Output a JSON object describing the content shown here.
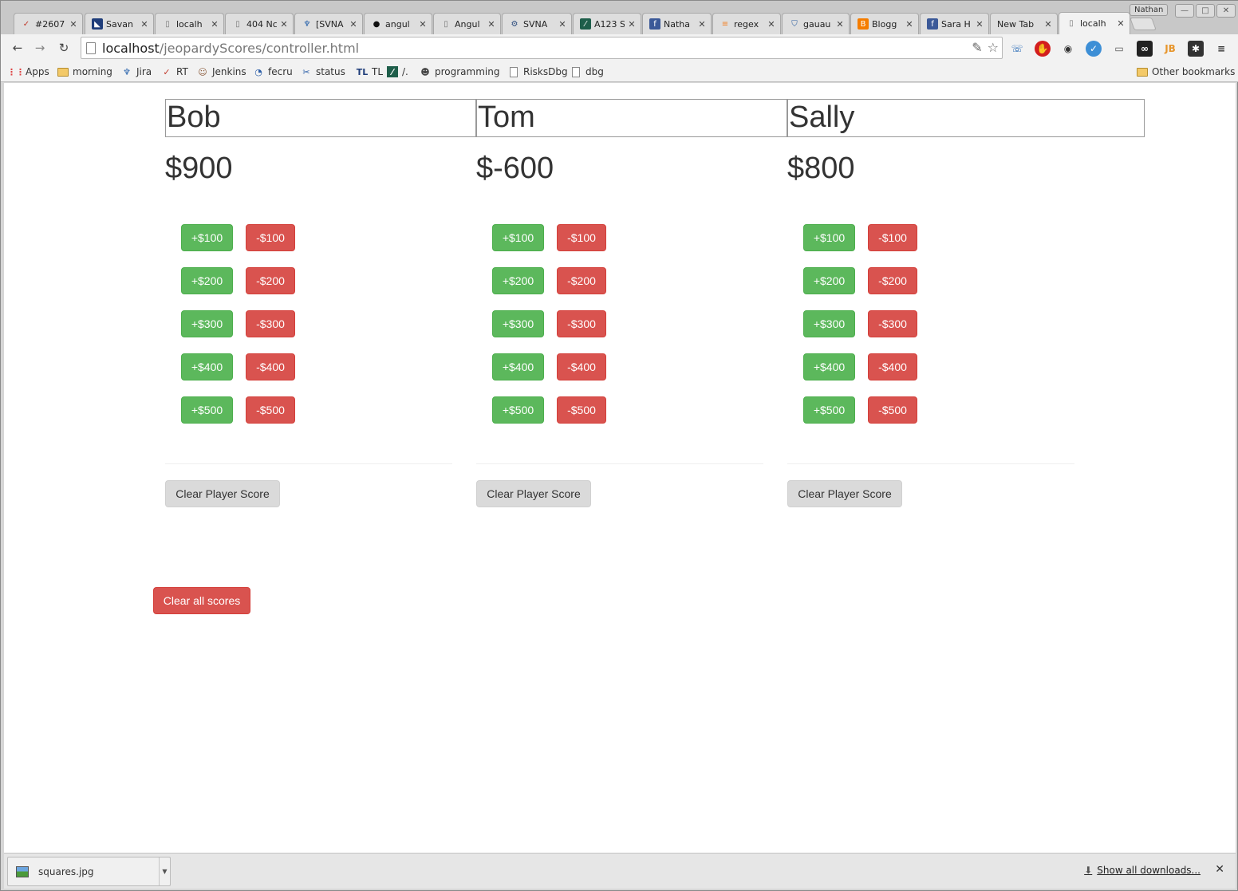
{
  "window": {
    "profile_name": "Nathan",
    "controls": {
      "minimize": "—",
      "maximize": "□",
      "close": "✕"
    }
  },
  "tabs": [
    {
      "title": "#2607",
      "icon": "checkmark-icon"
    },
    {
      "title": "Savan",
      "icon": "savannah-icon"
    },
    {
      "title": "localh",
      "icon": "page-icon"
    },
    {
      "title": "404 Nc",
      "icon": "page-icon"
    },
    {
      "title": "[SVNA",
      "icon": "jira-icon"
    },
    {
      "title": "angul",
      "icon": "github-icon"
    },
    {
      "title": "Angul",
      "icon": "page-icon"
    },
    {
      "title": "SVNA",
      "icon": "gear-icon"
    },
    {
      "title": "A123 S",
      "icon": "a123-icon"
    },
    {
      "title": "Natha",
      "icon": "facebook-icon"
    },
    {
      "title": "regex",
      "icon": "stackoverflow-icon"
    },
    {
      "title": "gauau",
      "icon": "shield-icon"
    },
    {
      "title": "Blogg",
      "icon": "blogger-icon"
    },
    {
      "title": "Sara H",
      "icon": "facebook-icon"
    },
    {
      "title": "New Tab",
      "icon": ""
    },
    {
      "title": "localh",
      "icon": "page-icon",
      "active": true
    }
  ],
  "toolbar": {
    "back": "←",
    "forward": "→",
    "reload": "↻",
    "url_host": "localhost",
    "url_path": "/jeopardyScores/controller.html"
  },
  "bookmarks": [
    {
      "label": "Apps",
      "icon": "apps-icon"
    },
    {
      "label": "morning",
      "icon": "folder-icon"
    },
    {
      "label": "Jira",
      "icon": "jira-icon"
    },
    {
      "label": "RT",
      "icon": "checkmark-icon"
    },
    {
      "label": "Jenkins",
      "icon": "jenkins-icon"
    },
    {
      "label": "fecru",
      "icon": "fecru-icon"
    },
    {
      "label": "status",
      "icon": "tools-icon"
    },
    {
      "label": "TL",
      "icon": "tl-icon"
    },
    {
      "label": "/.",
      "icon": "a123-icon"
    },
    {
      "label": "programming",
      "icon": "reddit-icon"
    },
    {
      "label": "RisksDbg",
      "icon": "page-icon"
    },
    {
      "label": "dbg",
      "icon": "page-icon"
    }
  ],
  "other_bookmarks": "Other bookmarks",
  "players": [
    {
      "name": "Bob",
      "score": "$900"
    },
    {
      "name": "Tom",
      "score": "$-600"
    },
    {
      "name": "Sally",
      "score": "$800"
    }
  ],
  "buttons": {
    "plus": [
      "+$100",
      "+$200",
      "+$300",
      "+$400",
      "+$500"
    ],
    "minus": [
      "-$100",
      "-$200",
      "-$300",
      "-$400",
      "-$500"
    ],
    "clear_player": "Clear Player Score",
    "clear_all": "Clear all scores"
  },
  "download_shelf": {
    "filename": "squares.jpg",
    "show_all": "Show all downloads...",
    "close": "✕"
  }
}
